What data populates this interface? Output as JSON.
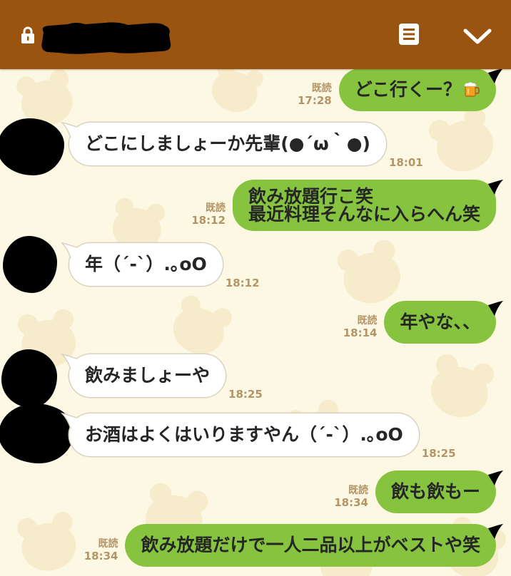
{
  "header": {
    "icons": {
      "lock": "lock-icon",
      "notes": "notes-icon",
      "collapse": "chevron-down-icon"
    }
  },
  "colors": {
    "header": "#9A5410",
    "sent_bubble": "#86C440",
    "received_bubble": "#FFFFFF",
    "chat_background": "#FDF8E3",
    "meta_text": "#B39466"
  },
  "messages": [
    {
      "text": "どこ行くー？",
      "emoji": "beer-icon",
      "read": "既読",
      "time": "17:28"
    },
    {
      "text": "どこにしましょーか先輩(●´ω｀●)",
      "time": "18:01"
    },
    {
      "lines": [
        "飲み放題行こ笑",
        "最近料理そんなに入らへん笑"
      ],
      "read": "既読",
      "time": "18:12"
    },
    {
      "text": "年（´-`）.｡oO",
      "time": "18:12"
    },
    {
      "text": "年やな、、",
      "read": "既読",
      "time": "18:14"
    },
    {
      "text": "飲みましょーや",
      "time": "18:25"
    },
    {
      "text": "お酒はよくはいりますやん（´-`）.｡oO",
      "time": "18:25"
    },
    {
      "text": "飲も飲もー",
      "read": "既読",
      "time": "18:34"
    },
    {
      "text": "飲み放題だけで一人二品以上がベストや笑",
      "read": "既読",
      "time": "18:34"
    }
  ]
}
